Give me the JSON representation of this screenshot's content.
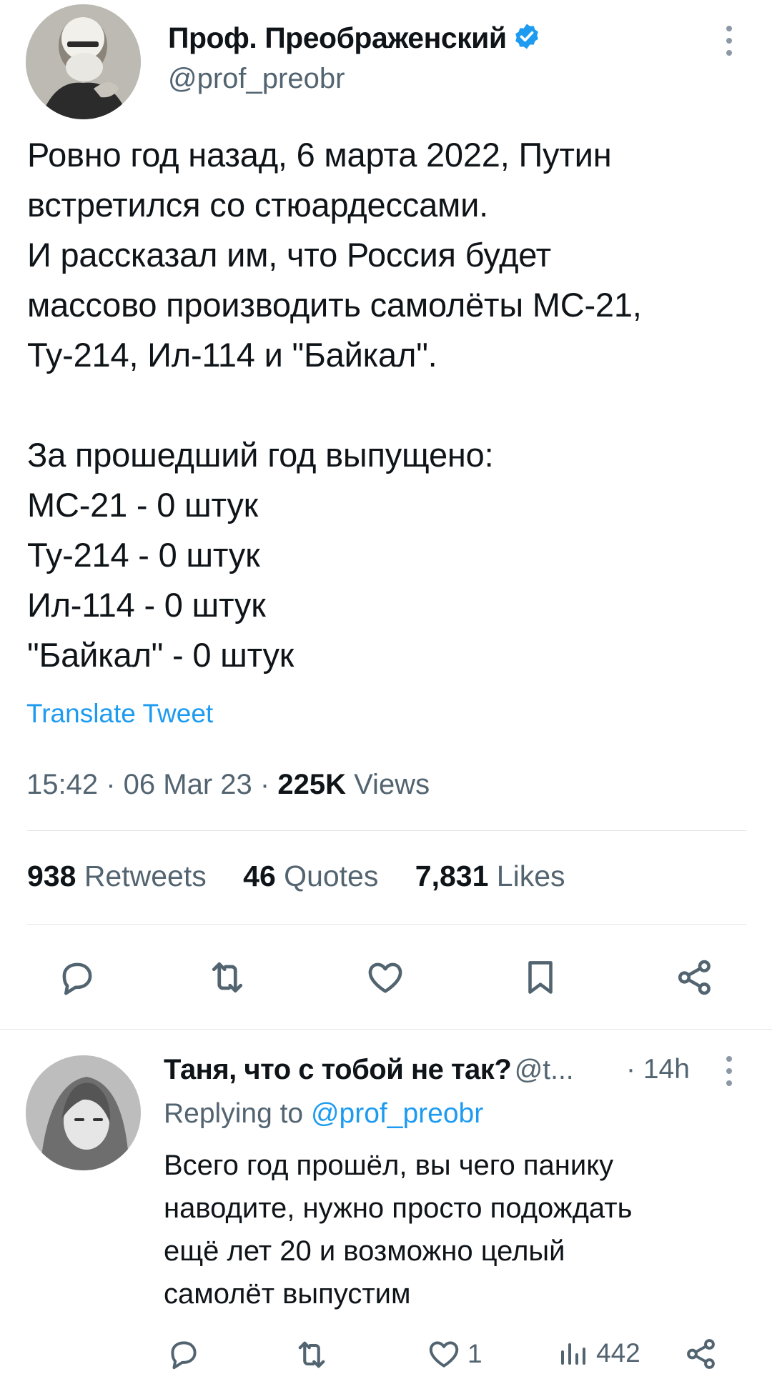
{
  "tweet": {
    "author_name": "Проф. Преображенский",
    "author_handle": "@prof_preobr",
    "text": "Ровно год назад, 6 марта 2022, Путин\nвстретился со стюардессами.\nИ рассказал им, что Россия будет\nмассово производить самолёты МС-21,\nТу-214, Ил-114 и \"Байкал\".\n\nЗа прошедший год выпущено:\nМС-21 - 0 штук\nТу-214 - 0 штук\nИл-114 - 0 штук\n\"Байкал\" - 0 штук",
    "translate_label": "Translate Tweet",
    "time": "15:42",
    "date": "06 Mar 23",
    "views_count": "225K",
    "views_label": "Views",
    "stats": {
      "retweets_count": "938",
      "retweets_label": "Retweets",
      "quotes_count": "46",
      "quotes_label": "Quotes",
      "likes_count": "7,831",
      "likes_label": "Likes"
    },
    "icons": [
      "reply-icon",
      "retweet-icon",
      "like-icon",
      "bookmark-icon",
      "share-icon"
    ]
  },
  "reply": {
    "author_name": "Таня, что с тобой не так?",
    "author_handle": "@t...",
    "time": "14h",
    "replying_to_label": "Replying to",
    "replying_to_handle": "@prof_preobr",
    "text": "Всего год прошёл, вы чего панику\nнаводите, нужно просто подождать\nещё лет 20 и возможно целый\nсамолёт выпустим",
    "likes_count": "1",
    "views_count": "442"
  },
  "colors": {
    "accent": "#1d9bf0",
    "secondary_text": "#536471",
    "primary_text": "#0f1419",
    "divider": "#e1e5e8"
  }
}
